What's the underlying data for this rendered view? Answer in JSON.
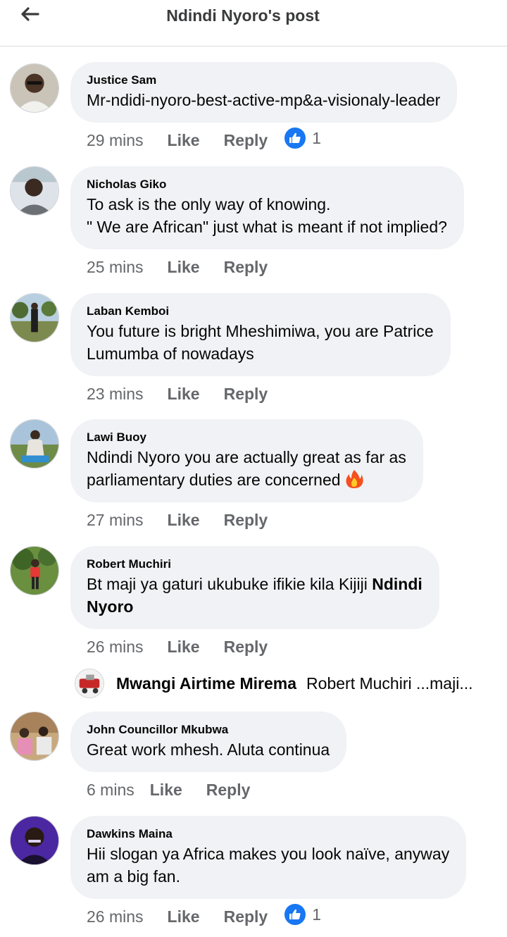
{
  "header": {
    "title": "Ndindi Nyoro's post",
    "back_icon": "arrow-left-icon"
  },
  "comments": [
    {
      "author": "Justice Sam",
      "lines": [
        "Mr-ndidi-nyoro-best-active-mp&a-visionaly-leader"
      ],
      "time": "29 mins",
      "like_label": "Like",
      "reply_label": "Reply",
      "reaction_count": "1"
    },
    {
      "author": "Nicholas Giko",
      "lines": [
        "To ask is the only way of knowing.",
        "\" We are African\" just what is meant if not implied?"
      ],
      "time": "25 mins",
      "like_label": "Like",
      "reply_label": "Reply"
    },
    {
      "author": "Laban Kemboi",
      "lines": [
        "You future is bright Mheshimiwa, you are Patrice",
        "Lumumba of nowadays"
      ],
      "time": "23 mins",
      "like_label": "Like",
      "reply_label": "Reply"
    },
    {
      "author": "Lawi Buoy",
      "lines": [
        "Ndindi Nyoro you are actually great as far as",
        "parliamentary duties are concerned"
      ],
      "emoji": "fire-emoji-icon",
      "time": "27 mins",
      "like_label": "Like",
      "reply_label": "Reply"
    },
    {
      "author": "Robert Muchiri",
      "lines": [
        "Bt maji ya gaturi ukubuke ifikie kila Kijiji "
      ],
      "mention_part1": "Ndindi",
      "mention_part2": "Nyoro",
      "time": "26 mins",
      "like_label": "Like",
      "reply_label": "Reply"
    },
    {
      "author": "John Councillor Mkubwa",
      "lines": [
        "Great work mhesh. Aluta continua"
      ],
      "time": "6 mins",
      "like_label": "Like",
      "reply_label": "Reply"
    },
    {
      "author": "Dawkins Maina",
      "lines": [
        "Hii slogan ya Africa makes you look naïve, anyway",
        "am a big fan."
      ],
      "time": "26 mins",
      "like_label": "Like",
      "reply_label": "Reply",
      "reaction_count": "1"
    }
  ],
  "reply_thread": {
    "author": "Mwangi Airtime Mirema",
    "preview": "Robert Muchiri ...maji..."
  },
  "colors": {
    "bubble": "#f0f2f5",
    "meta_text": "#65676b",
    "like_blue": "#1877f2",
    "divider": "#dadde1"
  }
}
